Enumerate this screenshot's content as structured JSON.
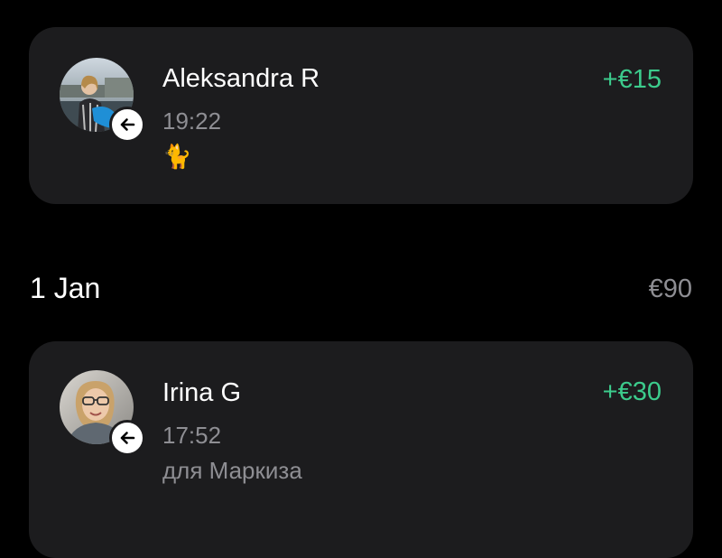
{
  "transactions": [
    {
      "name": "Aleksandra R",
      "time": "19:22",
      "note": "🐈",
      "amount": "+€15",
      "avatar_icon": "person-photo-icon",
      "badge_icon": "arrow-left-icon"
    },
    {
      "name": "Irina G",
      "time": "17:52",
      "note": "для Маркиза",
      "amount": "+€30",
      "avatar_icon": "person-photo-icon",
      "badge_icon": "arrow-left-icon"
    }
  ],
  "date_group": {
    "label": "1 Jan",
    "total": "€90"
  },
  "colors": {
    "background": "#000000",
    "card": "#1c1c1e",
    "positive_amount": "#3ccb8c",
    "secondary_text": "#8e8e93"
  }
}
